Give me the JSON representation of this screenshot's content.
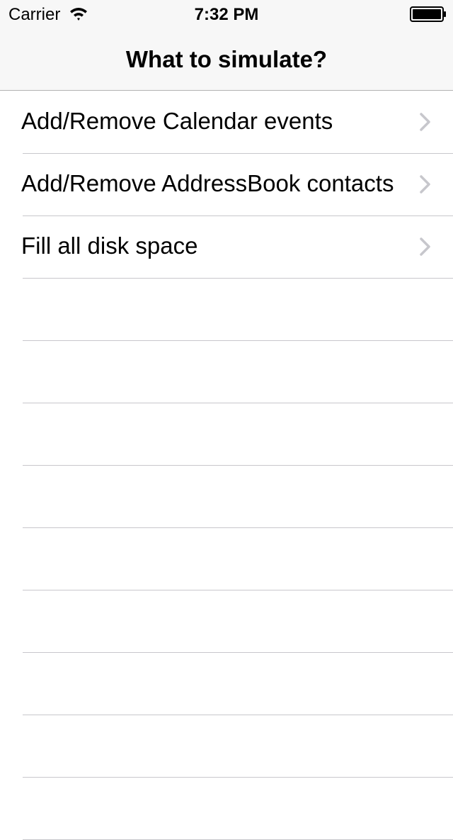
{
  "status_bar": {
    "carrier": "Carrier",
    "time": "7:32 PM",
    "wifi_icon": "wifi-icon",
    "battery_icon": "battery-icon"
  },
  "nav": {
    "title": "What to simulate?"
  },
  "list": {
    "items": [
      {
        "label": "Add/Remove Calendar events",
        "accessory": "chevron-right-icon"
      },
      {
        "label": "Add/Remove AddressBook contacts",
        "accessory": "chevron-right-icon"
      },
      {
        "label": "Fill all disk space",
        "accessory": "chevron-right-icon"
      }
    ],
    "separator_color": "#c8c7cc",
    "chevron_color": "#c7c7cc"
  },
  "colors": {
    "nav_background": "#f7f7f7",
    "background": "#ffffff"
  }
}
